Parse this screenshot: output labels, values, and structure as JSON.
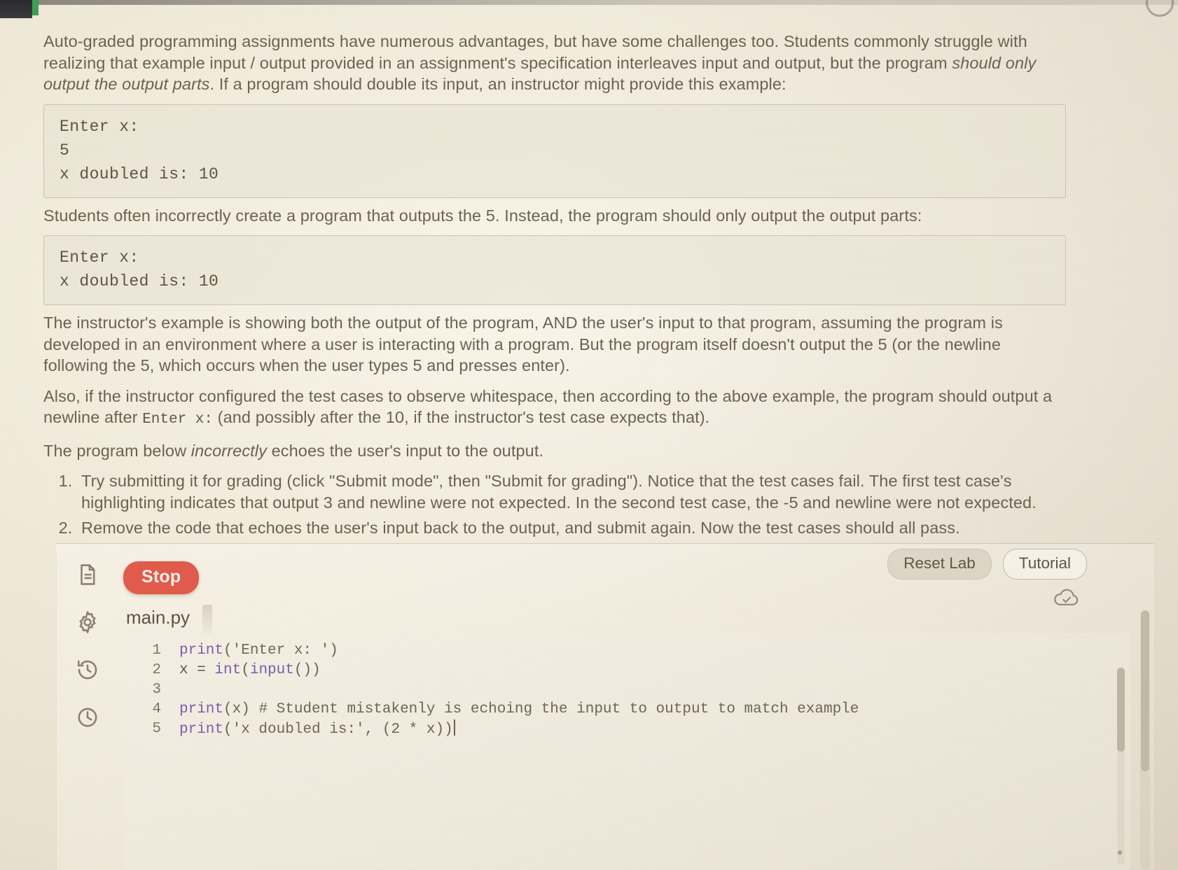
{
  "lesson": {
    "paragraph_1_a": "Auto-graded programming assignments have numerous advantages, but have some challenges too. Students commonly struggle with realizing that example input / output provided in an assignment's specification interleaves input and output, but the program ",
    "paragraph_1_em": "should only output the output parts",
    "paragraph_1_b": ". If a program should double its input, an instructor might provide this example:",
    "example_1": "Enter x:\n5\nx doubled is: 10",
    "paragraph_2": "Students often incorrectly create a program that outputs the 5. Instead, the program should only output the output parts:",
    "example_2": "Enter x:\nx doubled is: 10",
    "paragraph_3": "The instructor's example is showing both the output of the program, AND the user's input to that program, assuming the program is developed in an environment where a user is interacting with a program. But the program itself doesn't output the 5 (or the newline following the 5, which occurs when the user types 5 and presses enter).",
    "paragraph_4_a": "Also, if the instructor configured the test cases to observe whitespace, then according to the above example, the program should output a newline after ",
    "paragraph_4_mono": "Enter x:",
    "paragraph_4_b": " (and possibly after the 10, if the instructor's test case expects that).",
    "paragraph_5_a": "The program below ",
    "paragraph_5_em": "incorrectly",
    "paragraph_5_b": " echoes the user's input to the output.",
    "steps": [
      "Try submitting it for grading (click \"Submit mode\", then \"Submit for grading\"). Notice that the test cases fail. The first test case's highlighting indicates that output 3 and newline were not expected. In the second test case, the -5 and newline were not expected.",
      "Remove the code that echoes the user's input back to the output, and submit again. Now the test cases should all pass."
    ]
  },
  "lab": {
    "run_button_label": "Stop",
    "reset_label": "Reset Lab",
    "tutorial_label": "Tutorial",
    "file_tab": "main.py",
    "rail_icons": [
      "document-icon",
      "gear-icon",
      "history-icon",
      "clock-icon"
    ],
    "save_status_icon": "cloud-check-icon",
    "accent_color": "#e05b4b",
    "code_lines": [
      {
        "n": "1",
        "tokens": [
          {
            "t": "print",
            "c": "tok-fn"
          },
          {
            "t": "(",
            "c": "tok-punc"
          },
          {
            "t": "'Enter x: '",
            "c": "tok-str"
          },
          {
            "t": ")",
            "c": "tok-punc"
          }
        ]
      },
      {
        "n": "2",
        "tokens": [
          {
            "t": "x = ",
            "c": "tok-var"
          },
          {
            "t": "int",
            "c": "tok-fn"
          },
          {
            "t": "(",
            "c": "tok-punc"
          },
          {
            "t": "input",
            "c": "tok-fn"
          },
          {
            "t": "())",
            "c": "tok-punc"
          }
        ]
      },
      {
        "n": "3",
        "tokens": []
      },
      {
        "n": "4",
        "tokens": [
          {
            "t": "print",
            "c": "tok-fn"
          },
          {
            "t": "(x) ",
            "c": "tok-punc"
          },
          {
            "t": "# Student mistakenly is echoing the input to output to match example",
            "c": "tok-cmt"
          }
        ]
      },
      {
        "n": "5",
        "tokens": [
          {
            "t": "print",
            "c": "tok-fn"
          },
          {
            "t": "(",
            "c": "tok-punc"
          },
          {
            "t": "'x doubled is:'",
            "c": "tok-str"
          },
          {
            "t": ", (2 * x))",
            "c": "tok-punc"
          }
        ]
      }
    ]
  }
}
